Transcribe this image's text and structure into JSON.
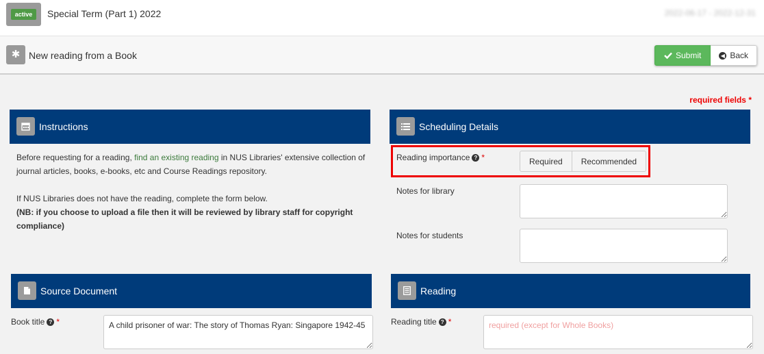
{
  "header": {
    "status": "active",
    "term": "Special Term (Part 1) 2022",
    "dates": "2022-06-17 - 2022-12-31"
  },
  "titlebar": {
    "title": "New reading from a Book",
    "submit": "Submit",
    "back": "Back"
  },
  "required_note": "required fields *",
  "instructions": {
    "title": "Instructions",
    "p1_before": "Before requesting for a reading, ",
    "p1_link": "find an existing reading",
    "p1_after": " in NUS Libraries' extensive collection of journal articles, books, e-books, etc and Course Readings repository.",
    "p2": "If NUS Libraries does not have the reading, complete the form below.",
    "p3": "(NB: if you choose to upload a file then it will be reviewed by library staff for copyright compliance)"
  },
  "scheduling": {
    "title": "Scheduling Details",
    "importance_label": "Reading importance",
    "options": [
      "Required",
      "Recommended"
    ],
    "notes_library_label": "Notes for library",
    "notes_students_label": "Notes for students"
  },
  "source": {
    "title": "Source Document",
    "book_title_label": "Book title",
    "book_title_value": "A child prisoner of war: The story of Thomas Ryan: Singapore 1942-45"
  },
  "reading": {
    "title": "Reading",
    "reading_title_label": "Reading title",
    "reading_title_placeholder": "required (except for Whole Books)"
  },
  "icons": {
    "status": "status-badge",
    "new": "asterisk-icon",
    "submit": "check-icon",
    "back": "arrow-left-circle-icon",
    "instructions": "calendar-icon",
    "scheduling": "list-icon",
    "source": "document-icon",
    "reading": "document-lines-icon",
    "help": "question-circle-icon"
  },
  "colors": {
    "panel_header": "#003b7a",
    "submit": "#5cb85c",
    "required": "#e00000",
    "status_badge": "#4f9a45"
  }
}
